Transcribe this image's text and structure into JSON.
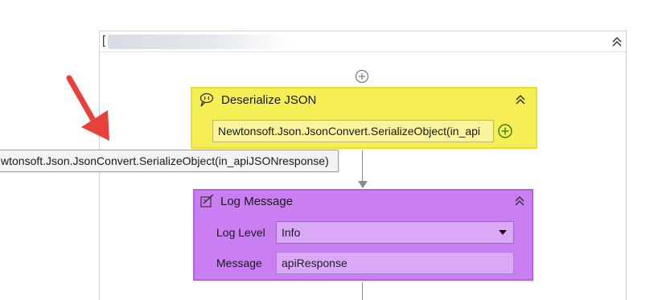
{
  "sequence": {
    "bracket": "["
  },
  "deserialize": {
    "title": "Deserialize JSON",
    "expression": "Newtonsoft.Json.JsonConvert.SerializeObject(in_api"
  },
  "log_message": {
    "title": "Log Message",
    "level_label": "Log Level",
    "level_value": "Info",
    "message_label": "Message",
    "message_value": "apiResponse"
  },
  "tooltip": {
    "text": "wtonsoft.Json.JsonConvert.SerializeObject(in_apiJSONresponse)"
  },
  "colors": {
    "deserialize_bg": "#f5ee55",
    "log_bg": "#c97ff2",
    "annotation_arrow": "#e8413c"
  },
  "icons": {
    "deserialize": "json-deserialize-icon",
    "log": "log-message-icon",
    "collapse": "double-chevron-up-icon",
    "add": "plus-circle-icon",
    "dropdown": "caret-down-icon"
  }
}
